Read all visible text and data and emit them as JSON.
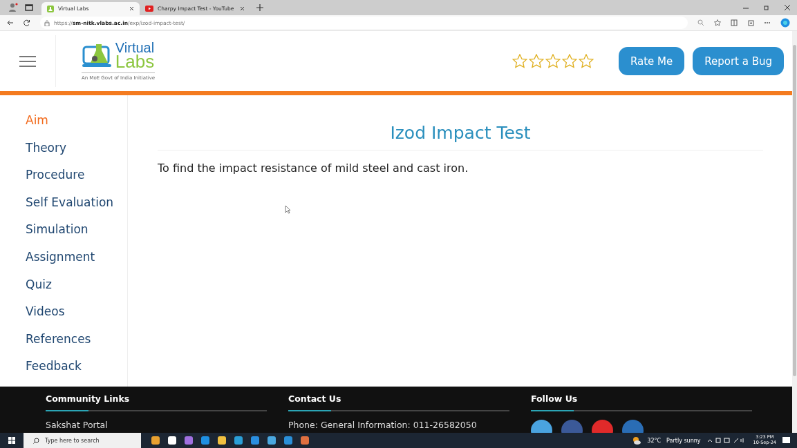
{
  "browser": {
    "tabs": [
      {
        "title": "Virtual Labs",
        "selected": true
      },
      {
        "title": "Charpy Impact Test - YouTube",
        "selected": false
      }
    ],
    "url_prefix": "https://",
    "url_host": "sm-nitk.vlabs.ac.in",
    "url_path": "/exp/izod-impact-test/"
  },
  "header": {
    "logo_top": "Virtual",
    "logo_bottom": "Labs",
    "tagline": "An MoE Govt of India Initiative",
    "rating": {
      "stars": 0
    },
    "buttons": [
      "Rate Me",
      "Report a Bug"
    ]
  },
  "sidebar": {
    "items": [
      {
        "label": "Aim",
        "selected": true
      },
      {
        "label": "Theory",
        "selected": false
      },
      {
        "label": "Procedure",
        "selected": false
      },
      {
        "label": "Self Evaluation",
        "selected": false
      },
      {
        "label": "Simulation",
        "selected": false
      },
      {
        "label": "Assignment",
        "selected": false
      },
      {
        "label": "Quiz",
        "selected": false
      },
      {
        "label": "Videos",
        "selected": false
      },
      {
        "label": "References",
        "selected": false
      },
      {
        "label": "Feedback",
        "selected": false
      }
    ]
  },
  "content": {
    "title": "Izod Impact Test",
    "text": "To find the impact resistance of mild steel and cast iron."
  },
  "footer": {
    "columns": [
      {
        "heading": "Community Links",
        "first_line": "Sakshat Portal"
      },
      {
        "heading": "Contact Us",
        "first_line": "Phone: General Information: 011-26582050"
      },
      {
        "heading": "Follow Us"
      }
    ],
    "social": [
      {
        "color": "#4aa3df"
      },
      {
        "color": "#3b5998"
      },
      {
        "color": "#e02a2a"
      },
      {
        "color": "#2a6db5"
      }
    ]
  },
  "taskbar": {
    "search_placeholder": "Type here to search",
    "weather": "32°C",
    "weather_text": "Partly sunny",
    "time": "3:23 PM",
    "date": "10-Sep-24"
  }
}
